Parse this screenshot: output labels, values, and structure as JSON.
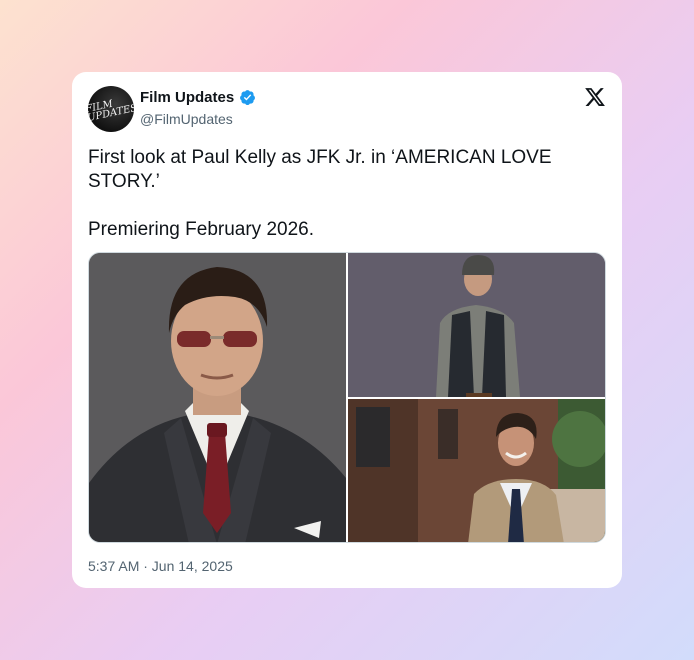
{
  "author": {
    "name": "Film Updates",
    "handle": "@FilmUpdates",
    "avatar_text": "FILM UPDATES",
    "verified_icon": "verified-badge-icon",
    "verified_color": "#1d9bf0"
  },
  "platform_icon": "x-logo-icon",
  "tweet": {
    "text": "First look at Paul Kelly as JFK Jr. in ‘AMERICAN LOVE STORY.’\n\nPremiering February 2026."
  },
  "media": {
    "photos": [
      "man-in-suit-sunglasses-photo",
      "man-in-vest-beanie-photo",
      "man-in-tan-blazer-street-photo"
    ]
  },
  "timestamp": "5:37 AM · Jun 14, 2025",
  "colors": {
    "text_primary": "#0f1419",
    "text_secondary": "#536471",
    "card_bg": "#ffffff"
  }
}
